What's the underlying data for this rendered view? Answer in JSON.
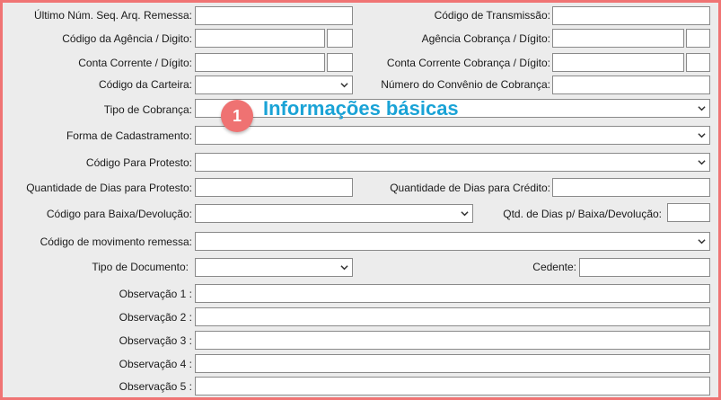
{
  "annotation": {
    "number": "1",
    "title": "Informações básicas",
    "color": "#ef7272",
    "title_color": "#1aa3d6"
  },
  "icons": {
    "dropdown": "chevron-down-icon"
  },
  "form": {
    "ultimo_num_seq": {
      "label": "Último Núm. Seq. Arq. Remessa:",
      "value": ""
    },
    "codigo_transmissao": {
      "label": "Código de Transmissão:",
      "value": ""
    },
    "codigo_agencia": {
      "label": "Código da Agência / Digito:",
      "value": "",
      "digit": ""
    },
    "agencia_cobranca": {
      "label": "Agência Cobrança / Dígito:",
      "value": "",
      "digit": ""
    },
    "conta_corrente": {
      "label": "Conta Corrente / Dígito:",
      "value": "",
      "digit": ""
    },
    "conta_corrente_cobranca": {
      "label": "Conta Corrente Cobrança / Dígito:",
      "value": "",
      "digit": ""
    },
    "codigo_carteira": {
      "label": "Código da Carteira:",
      "value": ""
    },
    "numero_convenio": {
      "label": "Número do Convênio de Cobrança:",
      "value": ""
    },
    "tipo_cobranca": {
      "label": "Tipo de Cobrança:",
      "value": ""
    },
    "forma_cadastramento": {
      "label": "Forma de Cadastramento:",
      "value": ""
    },
    "codigo_protesto": {
      "label": "Código Para Protesto:",
      "value": ""
    },
    "dias_protesto": {
      "label": "Quantidade de Dias para Protesto:",
      "value": ""
    },
    "dias_credito": {
      "label": "Quantidade de Dias para Crédito:",
      "value": ""
    },
    "codigo_baixa": {
      "label": "Código para Baixa/Devolução:",
      "value": ""
    },
    "dias_baixa": {
      "label": "Qtd. de Dias p/ Baixa/Devolução:",
      "value": ""
    },
    "codigo_movimento": {
      "label": "Código de movimento remessa:",
      "value": ""
    },
    "tipo_documento": {
      "label": "Tipo de Documento:",
      "value": ""
    },
    "cedente": {
      "label": "Cedente:",
      "value": ""
    },
    "observacoes": [
      {
        "label": "Observação 1 :",
        "value": ""
      },
      {
        "label": "Observação 2 :",
        "value": ""
      },
      {
        "label": "Observação 3 :",
        "value": ""
      },
      {
        "label": "Observação 4 :",
        "value": ""
      },
      {
        "label": "Observação 5 :",
        "value": ""
      }
    ]
  }
}
